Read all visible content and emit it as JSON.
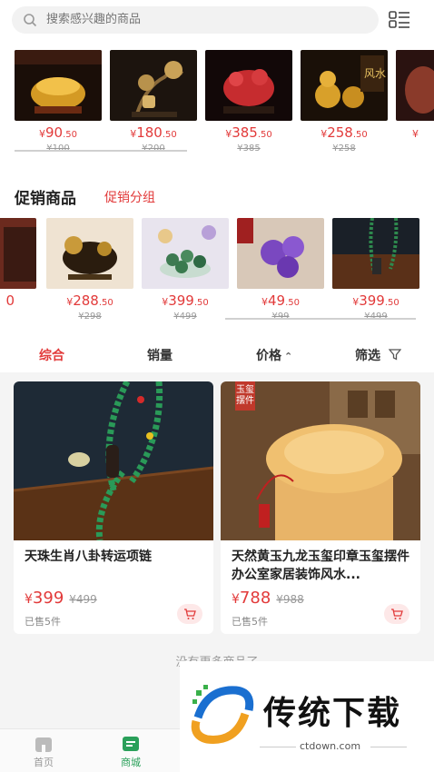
{
  "search": {
    "placeholder": "搜索感兴趣的商品"
  },
  "top_products": [
    {
      "price": "90",
      "cents": ".50",
      "old_price": "¥100",
      "color": "#c9921e"
    },
    {
      "price": "180",
      "cents": ".50",
      "old_price": "¥200",
      "color": "#6b4b2e"
    },
    {
      "price": "385",
      "cents": ".50",
      "old_price": "¥385",
      "color": "#b3262a"
    },
    {
      "price": "258",
      "cents": ".50",
      "old_price": "¥258",
      "color": "#c58a1c"
    }
  ],
  "promo": {
    "title": "促销商品",
    "link": "促销分组"
  },
  "promo_products": [
    {
      "price": "288",
      "cents": ".50",
      "old_price": "¥298",
      "color": "#3b2b18"
    },
    {
      "price": "399",
      "cents": ".50",
      "old_price": "¥499",
      "color": "#5a8a64"
    },
    {
      "price": "49",
      "cents": ".50",
      "old_price": "¥99",
      "color": "#7b4bc2"
    },
    {
      "price": "399",
      "cents": ".50",
      "old_price": "¥499",
      "color": "#2e6b3e"
    }
  ],
  "sort": {
    "comprehensive": "综合",
    "sales": "销量",
    "price": "价格",
    "filter": "筛选"
  },
  "cards": [
    {
      "title": "天珠生肖八卦转运项链",
      "price": "399",
      "old_price": "¥499",
      "sold": "已售5件"
    },
    {
      "title": "天然黄玉九龙玉玺印章玉玺摆件办公室家居装饰风水...",
      "price": "788",
      "old_price": "¥988",
      "sold": "已售5件",
      "badge": "玉玺摆件"
    }
  ],
  "yen": "¥",
  "no_more": "没有更多商品了",
  "tabs": {
    "home": "首页",
    "mall": "商城"
  },
  "watermark": {
    "title": "传统下载",
    "site": "ctdown.com"
  },
  "colors": {
    "accent": "#e23a3a",
    "active_tab": "#2aa05a"
  }
}
